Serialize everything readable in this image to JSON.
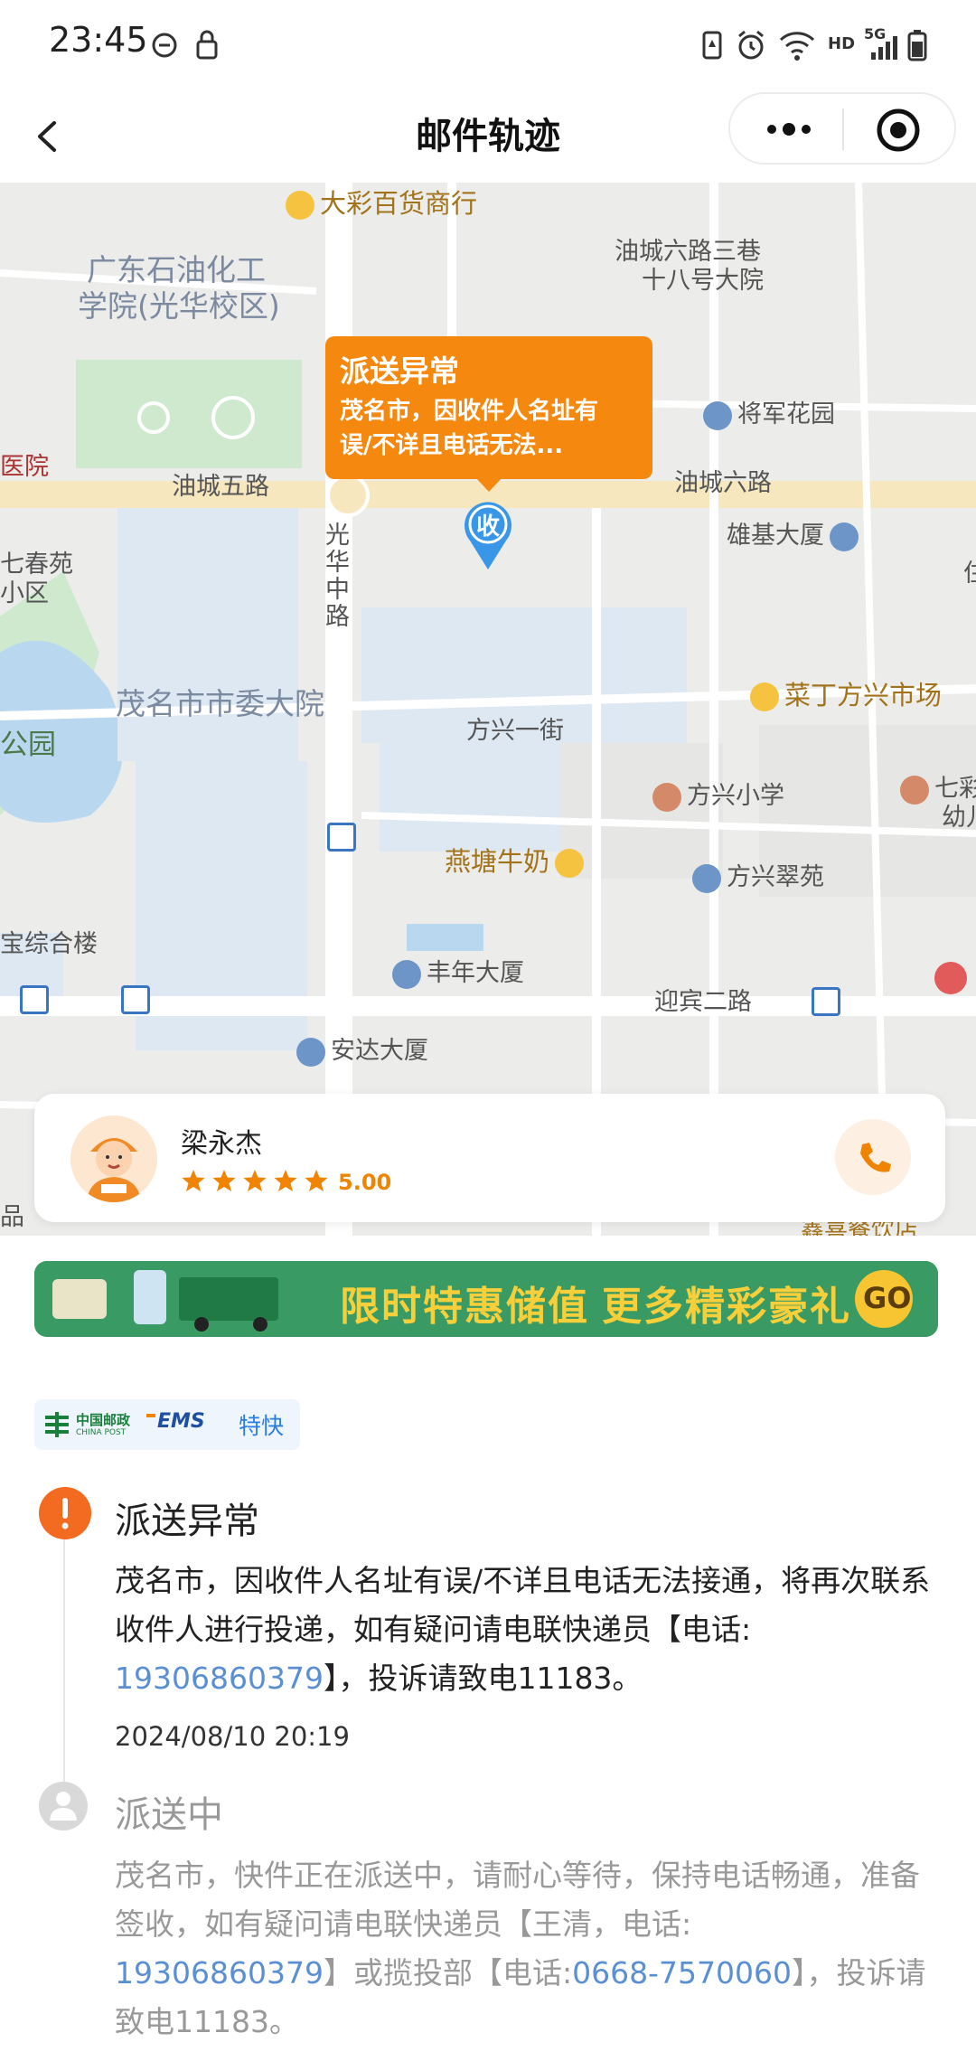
{
  "status_bar": {
    "time": "23:45",
    "network": "HD",
    "signal": "5G"
  },
  "nav": {
    "title": "邮件轨迹"
  },
  "map": {
    "callout": {
      "title": "派送异常",
      "body_line1": "茂名市，因收件人名址有",
      "body_line2": "误/不详且电话无法..."
    },
    "pin_label": "收",
    "labels": {
      "l1": "大彩百货商行",
      "l2a": "广东石油化工",
      "l2b": "学院(光华校区)",
      "l3a": "油城六路三巷",
      "l3b": "十八号大院",
      "l4": "将军花园",
      "l5": "油城五路",
      "l6": "油城六路",
      "l7": "雄基大厦",
      "l8": "医院",
      "l9a": "七春苑",
      "l9b": "小区",
      "l10": "光华中路",
      "l11": "茂名市市委大院",
      "l12": "方兴一街",
      "l13": "菜丁方兴市场",
      "l14": "方兴小学",
      "l15a": "七彩",
      "l15b": "幼儿",
      "l16": "公园",
      "l17": "燕塘牛奶",
      "l18": "方兴翠苑",
      "l19": "宝综合楼",
      "l20": "丰年大厦",
      "l21": "迎宾二路",
      "l22": "安达大厦",
      "l23": "鑫喜餐饮店",
      "l24": "品",
      "l25": "住"
    }
  },
  "courier": {
    "name": "梁永杰",
    "rating": "5.00",
    "stars": 5
  },
  "banner": {
    "text1": "限时特惠储值",
    "text2": "更多精彩豪礼",
    "go": "GO"
  },
  "brand": {
    "china_post": "中国邮政",
    "china_post_en": "CHINA POST",
    "ems": "EMS",
    "service": "特快"
  },
  "timeline": [
    {
      "status": "派送异常",
      "text_a": "茂名市，因收件人名址有误/不详且电话无法接通，将再次联系收件人进行投递，如有疑问请电联快递员【电话:",
      "phone": "19306860379",
      "text_b": "】，投诉请致电11183。",
      "time": "2024/08/10 20:19"
    },
    {
      "status": "派送中",
      "text_a": "茂名市，快件正在派送中，请耐心等待，保持电话畅通，准备签收，如有疑问请电联快递员【王清，电话:",
      "phone": "19306860379",
      "text_b": "】或揽投部【电话:",
      "phone2": "0668-7570060",
      "text_c": "】，投诉请致电11183。"
    }
  ],
  "colors": {
    "accent": "#f08300",
    "pin": "#3a97e8",
    "link": "#5b8fd3"
  }
}
